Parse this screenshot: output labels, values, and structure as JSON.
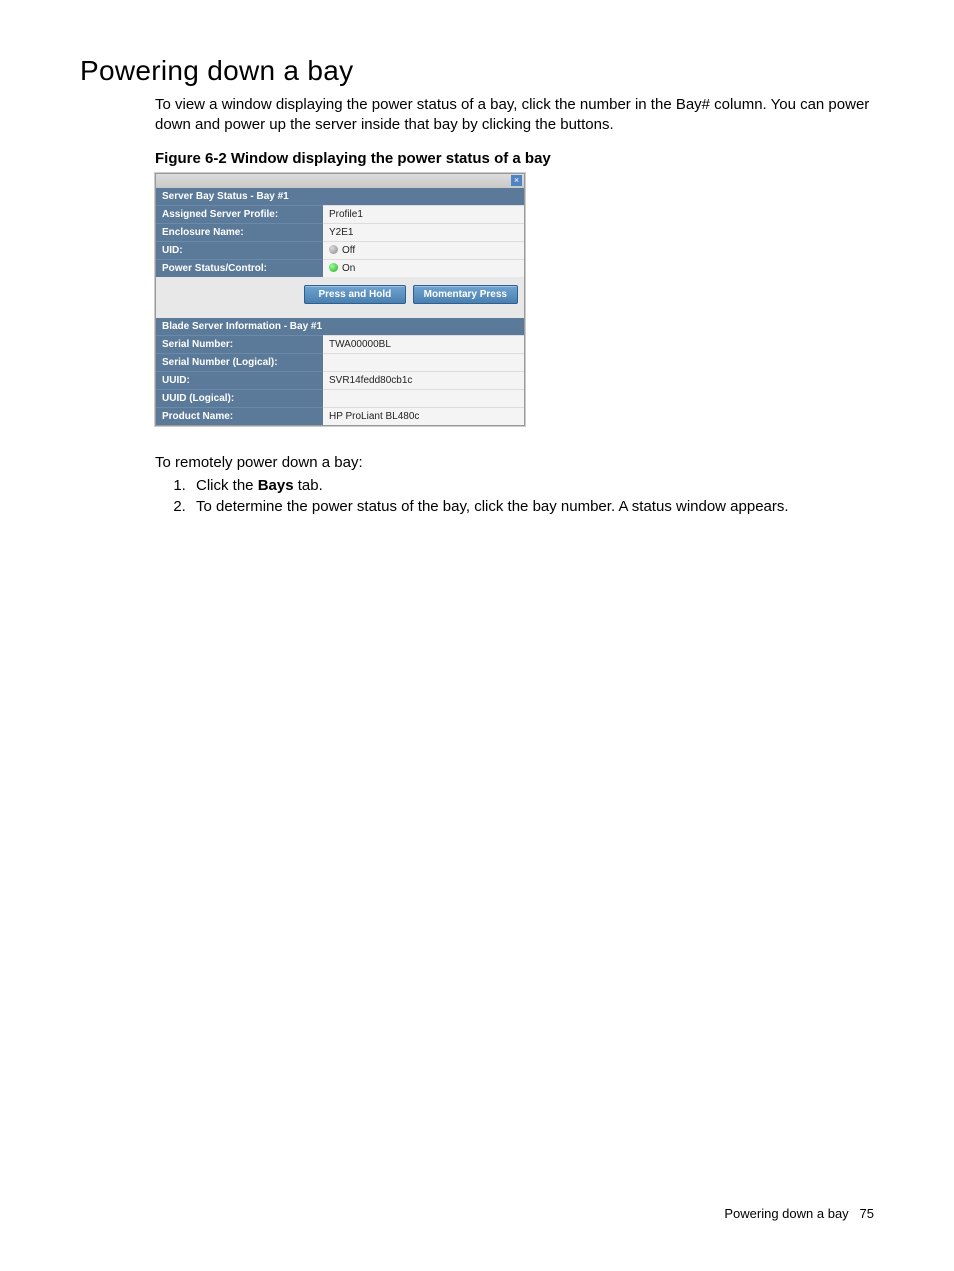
{
  "heading": "Powering down a bay",
  "intro": "To view a window displaying the power status of a bay, click the number in the Bay# column. You can power down and power up the server inside that bay by clicking the buttons.",
  "figure_caption": "Figure 6-2 Window displaying the power status of a bay",
  "dialog": {
    "section1_title": "Server Bay Status - Bay #1",
    "rows1": {
      "assigned_profile": {
        "k": "Assigned Server Profile:",
        "v": "Profile1"
      },
      "enclosure_name": {
        "k": "Enclosure Name:",
        "v": "Y2E1"
      },
      "uid": {
        "k": "UID:",
        "v": "Off"
      },
      "power_status": {
        "k": "Power Status/Control:",
        "v": "On"
      }
    },
    "btn_press_hold": "Press and Hold",
    "btn_momentary": "Momentary Press",
    "section2_title": "Blade Server Information - Bay #1",
    "rows2": {
      "serial": {
        "k": "Serial Number:",
        "v": "TWA00000BL"
      },
      "serial_logical": {
        "k": "Serial Number (Logical):",
        "v": ""
      },
      "uuid": {
        "k": "UUID:",
        "v": "SVR14fedd80cb1c"
      },
      "uuid_logical": {
        "k": "UUID (Logical):",
        "v": ""
      },
      "product": {
        "k": "Product Name:",
        "v": "HP ProLiant BL480c"
      }
    }
  },
  "after_shot": "To remotely power down a bay:",
  "step1_a": "Click the ",
  "step1_b": "Bays",
  "step1_c": " tab.",
  "step2": "To determine the power status of the bay, click the bay number. A status window appears.",
  "footer_text": "Powering down a bay",
  "footer_page": "75"
}
